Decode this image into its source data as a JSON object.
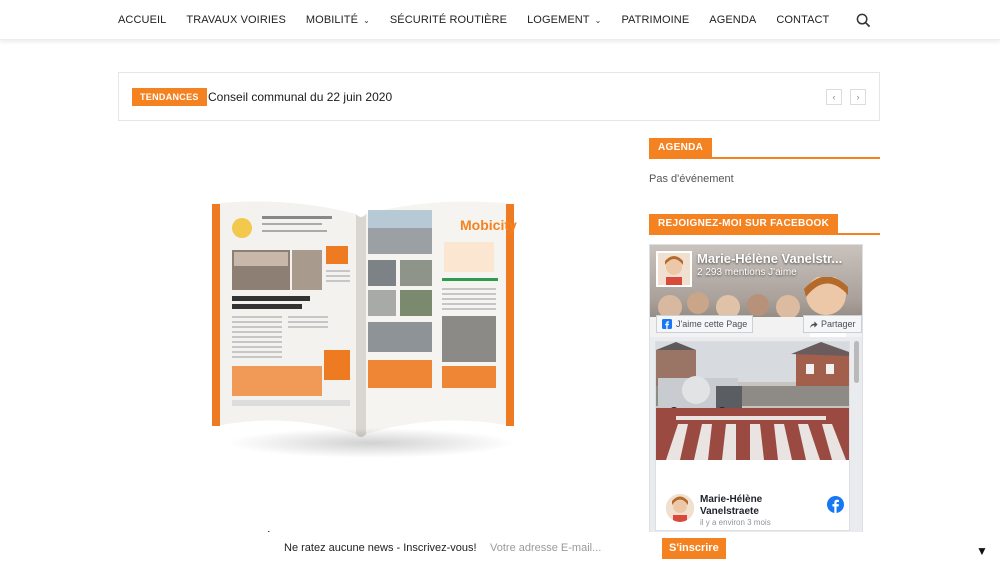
{
  "nav": {
    "items": [
      {
        "label": "ACCUEIL",
        "dropdown": false
      },
      {
        "label": "TRAVAUX VOIRIES",
        "dropdown": false
      },
      {
        "label": "MOBILITÉ",
        "dropdown": true
      },
      {
        "label": "SÉCURITÉ ROUTIÈRE",
        "dropdown": false
      },
      {
        "label": "LOGEMENT",
        "dropdown": true
      },
      {
        "label": "PATRIMOINE",
        "dropdown": false
      },
      {
        "label": "AGENDA",
        "dropdown": false
      },
      {
        "label": "CONTACT",
        "dropdown": false
      }
    ],
    "search_icon": "search-icon"
  },
  "trending": {
    "badge": "TENDANCES",
    "headline": "Conseil communal du 22 juin 2020",
    "prev": "‹",
    "next": "›"
  },
  "sidebar": {
    "agenda_title": "AGENDA",
    "no_event": "Pas d'événement",
    "facebook_title": "REJOIGNEZ-MOI SUR FACEBOOK",
    "facebook": {
      "page_name": "Marie-Hélène Vanelstr...",
      "likes": "2 293 mentions J'aime",
      "like_button": "J'aime cette Page",
      "share_button": "Partager",
      "post_author": "Marie-Hélène Vanelstraete",
      "post_time": "il y a environ 3 mois"
    }
  },
  "content": {
    "glyph": "é"
  },
  "newsletter": {
    "text": "Ne ratez aucune news - Inscrivez-vous!",
    "placeholder": "Votre adresse E-mail...",
    "button": "S'inscrire",
    "toggle": "▼"
  },
  "colors": {
    "accent": "#f58220",
    "facebook_blue": "#1877f2"
  }
}
